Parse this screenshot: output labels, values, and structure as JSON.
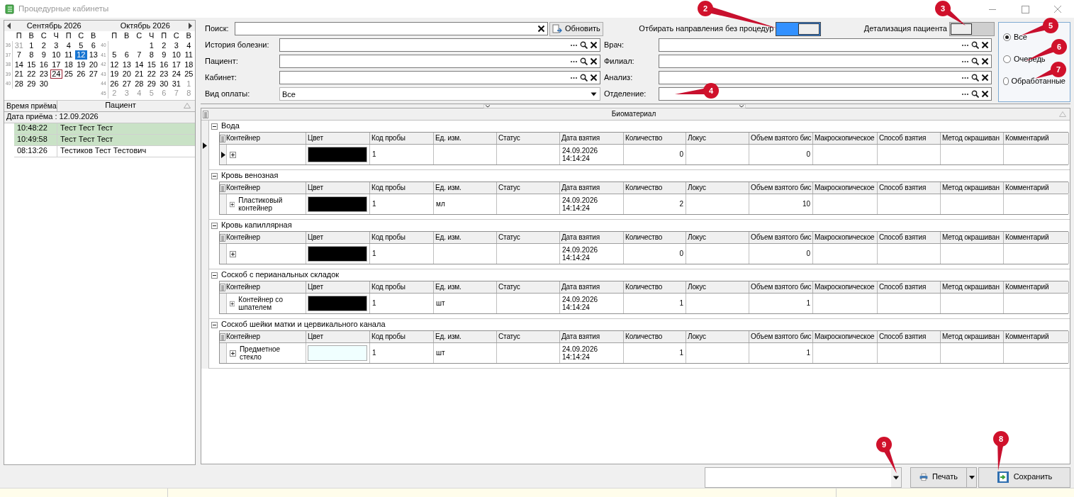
{
  "window": {
    "title": "Процедурные кабинеты"
  },
  "calendar": {
    "months": [
      {
        "title": "Сентябрь 2026",
        "weekdays": [
          "П",
          "В",
          "С",
          "Ч",
          "П",
          "С",
          "В"
        ],
        "weeks": [
          {
            "number": "36",
            "days": [
              {
                "day": "31",
                "other_month": true,
                "selected": false,
                "today": false
              },
              {
                "day": "1",
                "other_month": false,
                "selected": false,
                "today": false
              },
              {
                "day": "2",
                "other_month": false,
                "selected": false,
                "today": false
              },
              {
                "day": "3",
                "other_month": false,
                "selected": false,
                "today": false
              },
              {
                "day": "4",
                "other_month": false,
                "selected": false,
                "today": false
              },
              {
                "day": "5",
                "other_month": false,
                "selected": false,
                "today": false
              },
              {
                "day": "6",
                "other_month": false,
                "selected": false,
                "today": false
              }
            ]
          },
          {
            "number": "37",
            "days": [
              {
                "day": "7",
                "other_month": false,
                "selected": false,
                "today": false
              },
              {
                "day": "8",
                "other_month": false,
                "selected": false,
                "today": false
              },
              {
                "day": "9",
                "other_month": false,
                "selected": false,
                "today": false
              },
              {
                "day": "10",
                "other_month": false,
                "selected": false,
                "today": false
              },
              {
                "day": "11",
                "other_month": false,
                "selected": false,
                "today": false
              },
              {
                "day": "12",
                "other_month": false,
                "selected": true,
                "today": false
              },
              {
                "day": "13",
                "other_month": false,
                "selected": false,
                "today": false
              }
            ]
          },
          {
            "number": "38",
            "days": [
              {
                "day": "14",
                "other_month": false,
                "selected": false,
                "today": false
              },
              {
                "day": "15",
                "other_month": false,
                "selected": false,
                "today": false
              },
              {
                "day": "16",
                "other_month": false,
                "selected": false,
                "today": false
              },
              {
                "day": "17",
                "other_month": false,
                "selected": false,
                "today": false
              },
              {
                "day": "18",
                "other_month": false,
                "selected": false,
                "today": false
              },
              {
                "day": "19",
                "other_month": false,
                "selected": false,
                "today": false
              },
              {
                "day": "20",
                "other_month": false,
                "selected": false,
                "today": false
              }
            ]
          },
          {
            "number": "39",
            "days": [
              {
                "day": "21",
                "other_month": false,
                "selected": false,
                "today": false
              },
              {
                "day": "22",
                "other_month": false,
                "selected": false,
                "today": false
              },
              {
                "day": "23",
                "other_month": false,
                "selected": false,
                "today": false
              },
              {
                "day": "24",
                "other_month": false,
                "selected": false,
                "today": true
              },
              {
                "day": "25",
                "other_month": false,
                "selected": false,
                "today": false
              },
              {
                "day": "26",
                "other_month": false,
                "selected": false,
                "today": false
              },
              {
                "day": "27",
                "other_month": false,
                "selected": false,
                "today": false
              }
            ]
          },
          {
            "number": "40",
            "days": [
              {
                "day": "28",
                "other_month": false,
                "selected": false,
                "today": false
              },
              {
                "day": "29",
                "other_month": false,
                "selected": false,
                "today": false
              },
              {
                "day": "30",
                "other_month": false,
                "selected": false,
                "today": false
              }
            ]
          }
        ]
      },
      {
        "title": "Октябрь 2026",
        "weekdays": [
          "П",
          "В",
          "С",
          "Ч",
          "П",
          "С",
          "В"
        ],
        "weeks": [
          {
            "number": "40",
            "days": [
              {
                "day": "1",
                "other_month": false,
                "selected": false,
                "today": false
              },
              {
                "day": "2",
                "other_month": false,
                "selected": false,
                "today": false
              },
              {
                "day": "3",
                "other_month": false,
                "selected": false,
                "today": false
              },
              {
                "day": "4",
                "other_month": false,
                "selected": false,
                "today": false
              }
            ]
          },
          {
            "number": "41",
            "days": [
              {
                "day": "5",
                "other_month": false,
                "selected": false,
                "today": false
              },
              {
                "day": "6",
                "other_month": false,
                "selected": false,
                "today": false
              },
              {
                "day": "7",
                "other_month": false,
                "selected": false,
                "today": false
              },
              {
                "day": "8",
                "other_month": false,
                "selected": false,
                "today": false
              },
              {
                "day": "9",
                "other_month": false,
                "selected": false,
                "today": false
              },
              {
                "day": "10",
                "other_month": false,
                "selected": false,
                "today": false
              },
              {
                "day": "11",
                "other_month": false,
                "selected": false,
                "today": false
              }
            ]
          },
          {
            "number": "42",
            "days": [
              {
                "day": "12",
                "other_month": false,
                "selected": false,
                "today": false
              },
              {
                "day": "13",
                "other_month": false,
                "selected": false,
                "today": false
              },
              {
                "day": "14",
                "other_month": false,
                "selected": false,
                "today": false
              },
              {
                "day": "15",
                "other_month": false,
                "selected": false,
                "today": false
              },
              {
                "day": "16",
                "other_month": false,
                "selected": false,
                "today": false
              },
              {
                "day": "17",
                "other_month": false,
                "selected": false,
                "today": false
              },
              {
                "day": "18",
                "other_month": false,
                "selected": false,
                "today": false
              }
            ]
          },
          {
            "number": "43",
            "days": [
              {
                "day": "19",
                "other_month": false,
                "selected": false,
                "today": false
              },
              {
                "day": "20",
                "other_month": false,
                "selected": false,
                "today": false
              },
              {
                "day": "21",
                "other_month": false,
                "selected": false,
                "today": false
              },
              {
                "day": "22",
                "other_month": false,
                "selected": false,
                "today": false
              },
              {
                "day": "23",
                "other_month": false,
                "selected": false,
                "today": false
              },
              {
                "day": "24",
                "other_month": false,
                "selected": false,
                "today": false
              },
              {
                "day": "25",
                "other_month": false,
                "selected": false,
                "today": false
              }
            ]
          },
          {
            "number": "44",
            "days": [
              {
                "day": "26",
                "other_month": false,
                "selected": false,
                "today": false
              },
              {
                "day": "27",
                "other_month": false,
                "selected": false,
                "today": false
              },
              {
                "day": "28",
                "other_month": false,
                "selected": false,
                "today": false
              },
              {
                "day": "29",
                "other_month": false,
                "selected": false,
                "today": false
              },
              {
                "day": "30",
                "other_month": false,
                "selected": false,
                "today": false
              },
              {
                "day": "31",
                "other_month": false,
                "selected": false,
                "today": false
              },
              {
                "day": "1",
                "other_month": true,
                "selected": false,
                "today": false
              }
            ]
          },
          {
            "number": "45",
            "days": [
              {
                "day": "2",
                "other_month": true,
                "selected": false,
                "today": false
              },
              {
                "day": "3",
                "other_month": true,
                "selected": false,
                "today": false
              },
              {
                "day": "4",
                "other_month": true,
                "selected": false,
                "today": false
              },
              {
                "day": "5",
                "other_month": true,
                "selected": false,
                "today": false
              },
              {
                "day": "6",
                "other_month": true,
                "selected": false,
                "today": false
              },
              {
                "day": "7",
                "other_month": true,
                "selected": false,
                "today": false
              },
              {
                "day": "8",
                "other_month": true,
                "selected": false,
                "today": false
              }
            ]
          }
        ]
      }
    ]
  },
  "appointments": {
    "columns": [
      "Время приёма",
      "Пациент"
    ],
    "groups": [
      {
        "label": "Дата приёма : 12.09.2026",
        "rows": [
          {
            "time": "10:48:22",
            "patient": "Тест Тест Тест",
            "selected": true
          },
          {
            "time": "10:49:58",
            "patient": "Тест Тест Тест",
            "selected": true
          },
          {
            "time": "08:13:26",
            "patient": "Тестиков Тест Тестович",
            "selected": false
          }
        ]
      }
    ]
  },
  "filters": {
    "search": {
      "label": "Поиск:"
    },
    "refresh_button": "Обновить",
    "toggles": [
      {
        "label": "Отбирать направления без процедур",
        "on": true
      },
      {
        "label": "Детализация пациента",
        "on": false
      }
    ],
    "fields": [
      {
        "label": "История болезни:",
        "kind": "lookup"
      },
      {
        "label": "Врач:",
        "kind": "lookup"
      },
      {
        "label": "Пациент:",
        "kind": "lookup"
      },
      {
        "label": "Филиал:",
        "kind": "lookup"
      },
      {
        "label": "Кабинет:",
        "kind": "lookup"
      },
      {
        "label": "Анализ:",
        "kind": "lookup"
      },
      {
        "label": "Вид оплаты:",
        "kind": "dropdown",
        "value": "Все"
      },
      {
        "label": "Отделение:",
        "kind": "lookup"
      }
    ]
  },
  "view_filter": [
    {
      "label": "Все",
      "selected": true
    },
    {
      "label": "Очередь",
      "selected": false
    },
    {
      "label": "Обработанные",
      "selected": false
    }
  ],
  "biomaterial_grid": {
    "title": "Биоматериал",
    "groups": [
      {
        "name": "Вода",
        "expanded": true,
        "current": true,
        "columns": [
          "Контейнер",
          "Цвет",
          "Код пробы",
          "Ед. изм.",
          "Статус",
          "Дата взятия",
          "Количество",
          "Локус",
          "Объем взятого бис",
          "Макроскопическое",
          "Способ взятия",
          "Метод окрашиван",
          "Комментарий"
        ],
        "rows": [
          {
            "expanded": false,
            "current": true,
            "color": "#000000",
            "sample_code": "1",
            "date": "24.09.2026 14:14:24",
            "quantity": "0",
            "volume": "0"
          }
        ]
      },
      {
        "name": "Кровь венозная",
        "expanded": true,
        "current": false,
        "columns": [
          "Контейнер",
          "Цвет",
          "Код пробы",
          "Ед. изм.",
          "Статус",
          "Дата взятия",
          "Количество",
          "Локус",
          "Объем взятого бис",
          "Макроскопическое",
          "Способ взятия",
          "Метод окрашиван",
          "Комментарий"
        ],
        "rows": [
          {
            "expanded": false,
            "current": false,
            "container": "Пластиковый контейнер",
            "color": "#000000",
            "sample_code": "1",
            "unit": "мл",
            "date": "24.09.2026 14:14:24",
            "quantity": "2",
            "volume": "10"
          }
        ]
      },
      {
        "name": "Кровь капиллярная",
        "expanded": true,
        "current": false,
        "columns": [
          "Контейнер",
          "Цвет",
          "Код пробы",
          "Ед. изм.",
          "Статус",
          "Дата взятия",
          "Количество",
          "Локус",
          "Объем взятого бис",
          "Макроскопическое",
          "Способ взятия",
          "Метод окрашиван",
          "Комментарий"
        ],
        "rows": [
          {
            "expanded": false,
            "current": false,
            "color": "#000000",
            "sample_code": "1",
            "date": "24.09.2026 14:14:24",
            "quantity": "0",
            "volume": "0"
          }
        ]
      },
      {
        "name": "Соскоб с перианальных складок",
        "expanded": true,
        "current": false,
        "columns": [
          "Контейнер",
          "Цвет",
          "Код пробы",
          "Ед. изм.",
          "Статус",
          "Дата взятия",
          "Количество",
          "Локус",
          "Объем взятого бис",
          "Макроскопическое",
          "Способ взятия",
          "Метод окрашиван",
          "Комментарий"
        ],
        "rows": [
          {
            "expanded": false,
            "current": false,
            "container": "Контейнер со шпателем",
            "color": "#000000",
            "sample_code": "1",
            "unit": "шт",
            "date": "24.09.2026 14:14:24",
            "quantity": "1",
            "volume": "1"
          }
        ]
      },
      {
        "name": "Соскоб шейки матки и цервикального канала",
        "expanded": true,
        "current": false,
        "columns": [
          "Контейнер",
          "Цвет",
          "Код пробы",
          "Ед. изм.",
          "Статус",
          "Дата взятия",
          "Количество",
          "Локус",
          "Объем взятого бис",
          "Макроскопическое",
          "Способ взятия",
          "Метод окрашиван",
          "Комментарий"
        ],
        "rows": [
          {
            "expanded": false,
            "current": false,
            "container": "Предметное стекло",
            "color": "#f0ffff",
            "sample_code": "1",
            "unit": "шт",
            "date": "24.09.2026 14:14:24",
            "quantity": "1",
            "volume": "1"
          }
        ]
      }
    ]
  },
  "footer": {
    "print_button": "Печать",
    "save_button": "Сохранить"
  },
  "callouts": [
    {
      "number": "2"
    },
    {
      "number": "3"
    },
    {
      "number": "4"
    },
    {
      "number": "5"
    },
    {
      "number": "6"
    },
    {
      "number": "7"
    },
    {
      "number": "8"
    },
    {
      "number": "9"
    }
  ]
}
